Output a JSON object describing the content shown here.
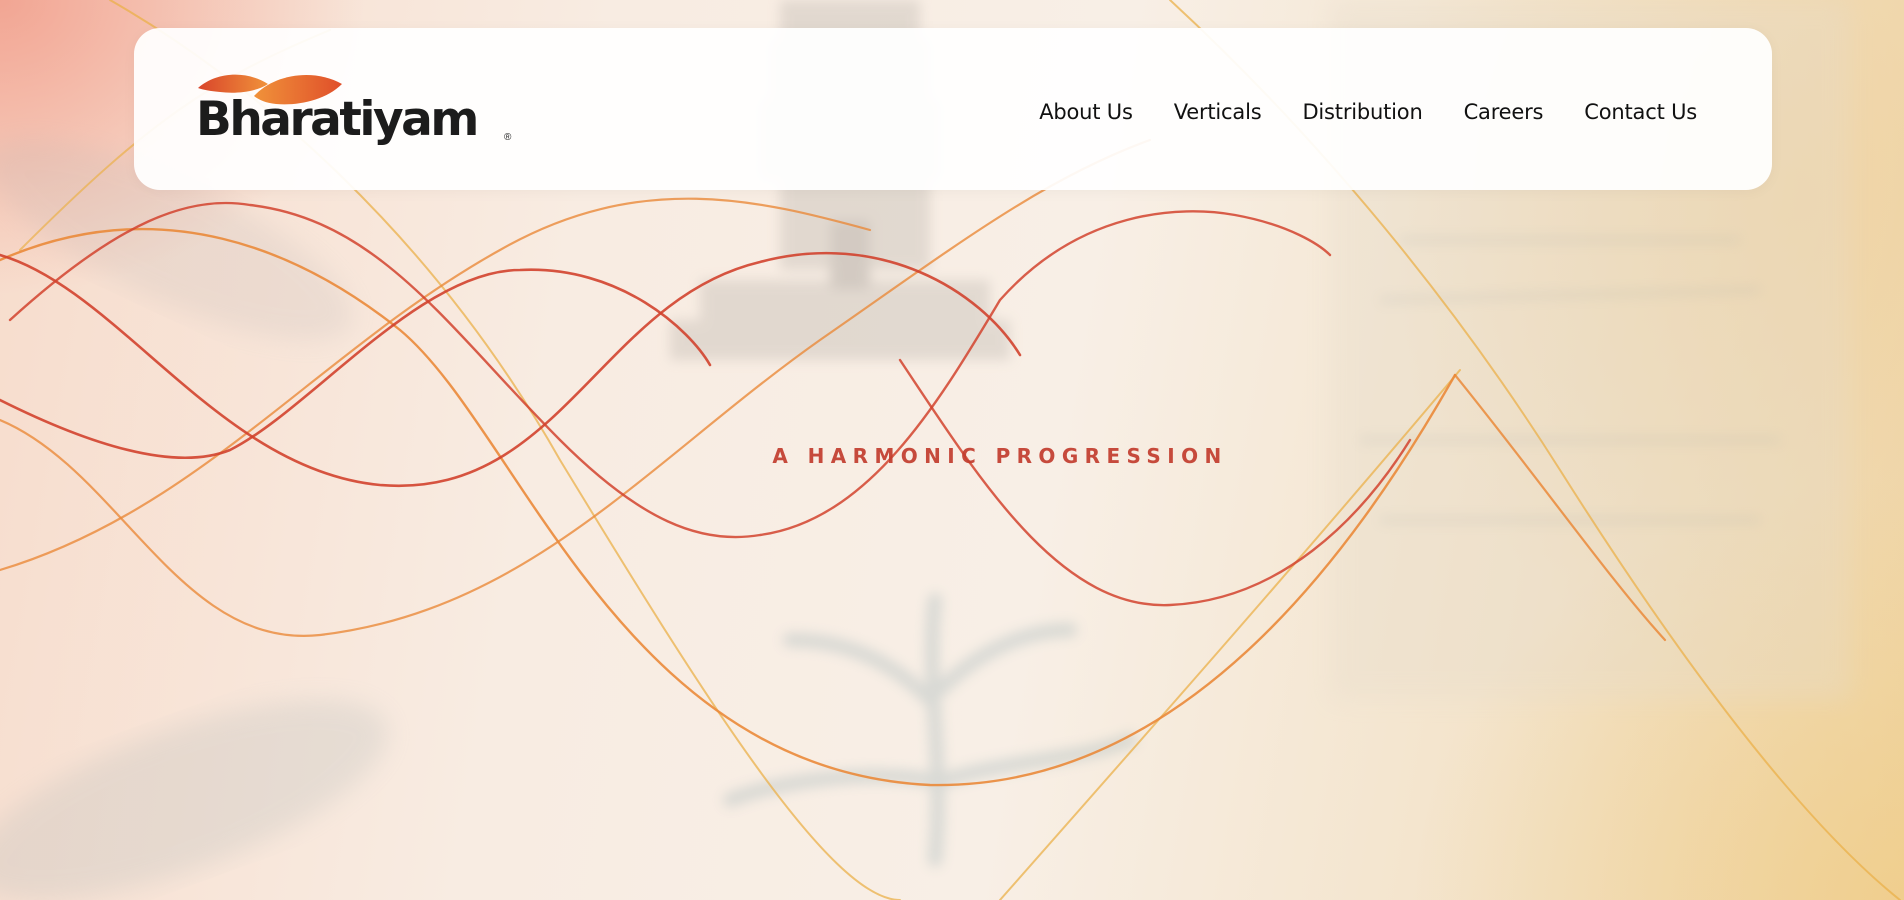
{
  "brand": {
    "name": "Bharatiyam",
    "registered_mark": "®",
    "colors": {
      "mark_red": "#d9452b",
      "mark_orange": "#f0923a",
      "text": "#1c1c1c"
    }
  },
  "nav": {
    "items": [
      {
        "label": "About Us"
      },
      {
        "label": "Verticals"
      },
      {
        "label": "Distribution"
      },
      {
        "label": "Careers"
      },
      {
        "label": "Contact Us"
      }
    ]
  },
  "hero": {
    "tagline": "A HARMONIC PROGRESSION",
    "colors": {
      "tagline": "#c23d2e",
      "wave_red": "#d2432e",
      "wave_orange": "#ea8a3a",
      "wave_gold": "#ebb04a"
    }
  }
}
